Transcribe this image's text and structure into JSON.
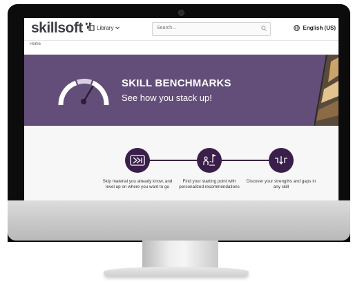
{
  "header": {
    "logo": "skillsoft",
    "library_label": "Library",
    "search_placeholder": "Search...",
    "language_label": "English (US)"
  },
  "breadcrumb": "Home",
  "hero": {
    "title": "SKILL BENCHMARKS",
    "subtitle": "See how you stack up!"
  },
  "steps": [
    {
      "icon": "fast-forward-icon",
      "text": "Skip material you already know, and level up on where you want to go"
    },
    {
      "icon": "person-flag-icon",
      "text": "Find your starting point with personalized recommendations"
    },
    {
      "icon": "strengths-gaps-icon",
      "text": "Discover your strengths and gaps in any skill"
    }
  ],
  "colors": {
    "hero_bg": "#634e79",
    "step_circle": "#3a1f4a",
    "logo_text": "#3e3f44"
  }
}
